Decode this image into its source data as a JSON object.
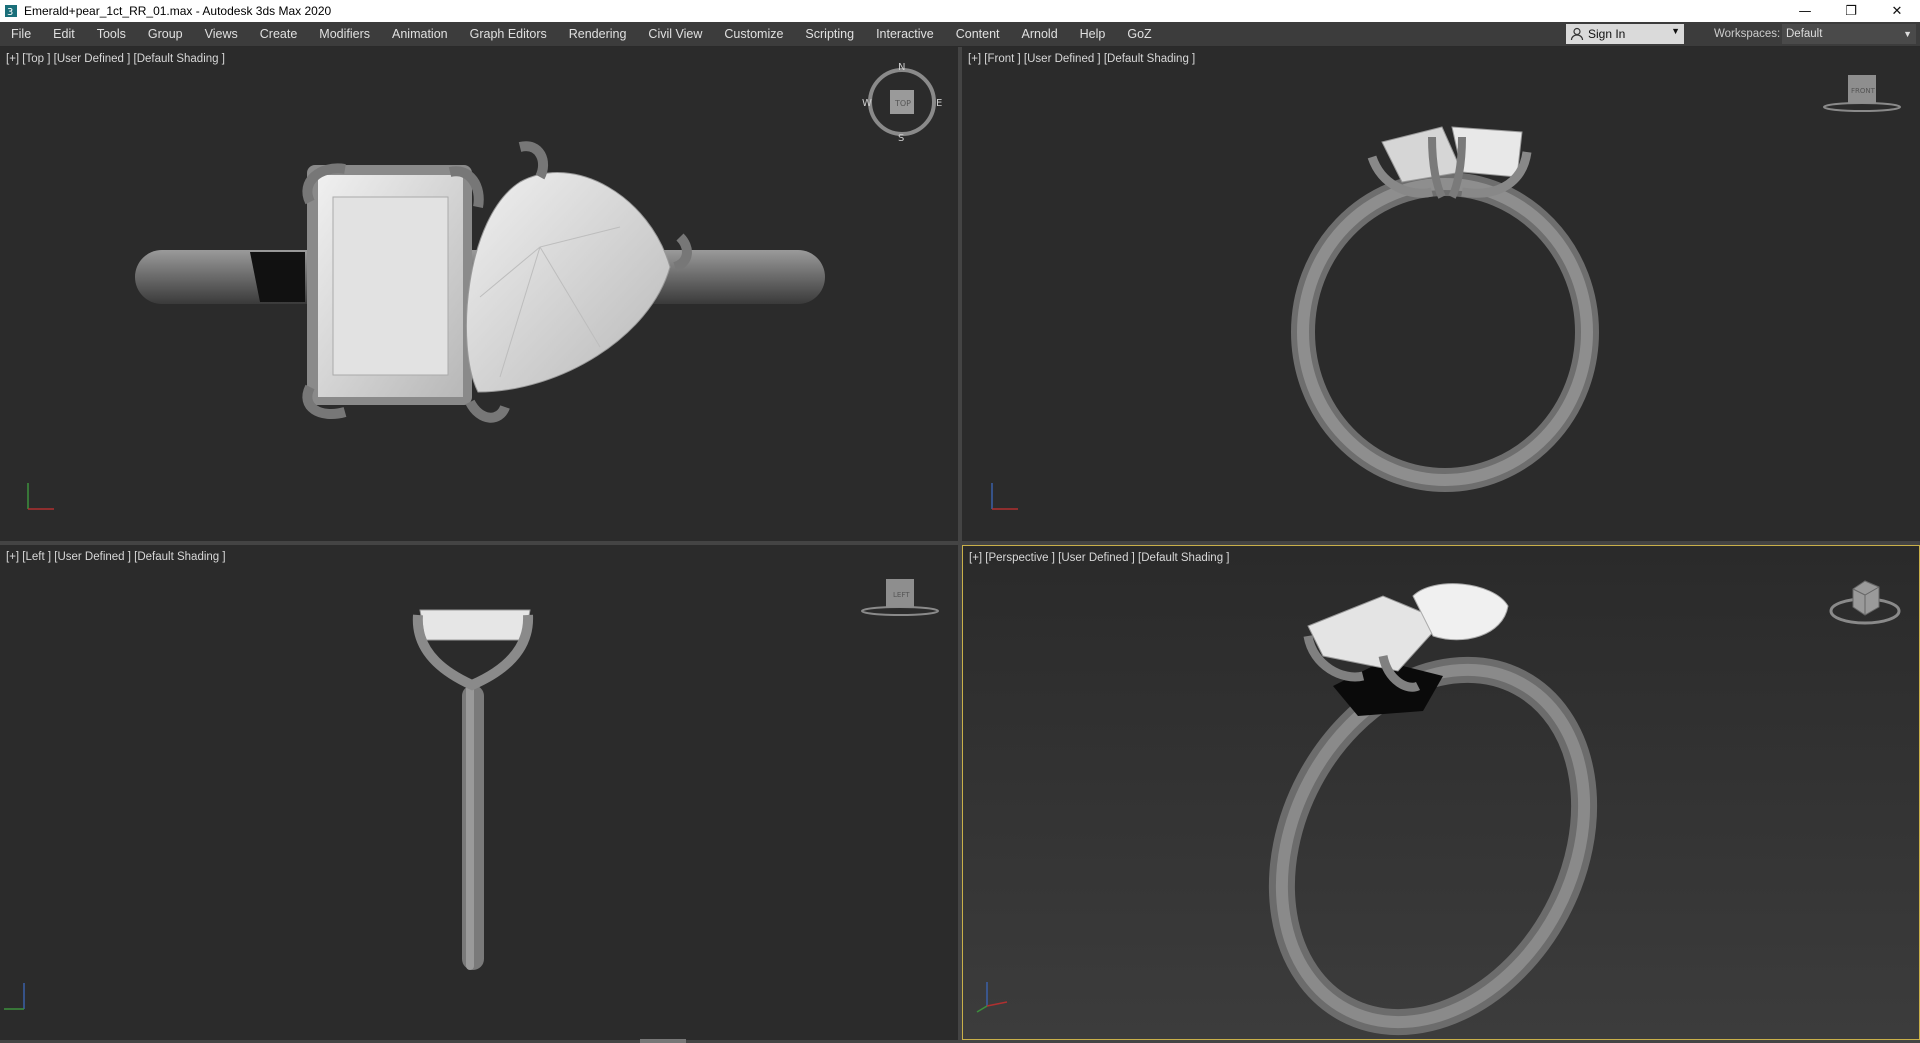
{
  "titlebar": {
    "title": "Emerald+pear_1ct_RR_01.max - Autodesk 3ds Max 2020",
    "minimize": "—",
    "restore": "❐",
    "close": "✕"
  },
  "menubar": {
    "items": [
      "File",
      "Edit",
      "Tools",
      "Group",
      "Views",
      "Create",
      "Modifiers",
      "Animation",
      "Graph Editors",
      "Rendering",
      "Civil View",
      "Customize",
      "Scripting",
      "Interactive",
      "Content",
      "Arnold",
      "Help",
      "GoZ"
    ]
  },
  "account": {
    "sign_in_label": "Sign In"
  },
  "workspace": {
    "label": "Workspaces:",
    "value": "Default"
  },
  "viewports": {
    "top": {
      "label": "[+] [Top ] [User Defined ] [Default Shading ]",
      "cube_label": "TOP",
      "compass": [
        "N",
        "E",
        "S",
        "W"
      ]
    },
    "front": {
      "label": "[+] [Front ] [User Defined ] [Default Shading ]",
      "cube_label": "FRONT"
    },
    "left": {
      "label": "[+] [Left ] [User Defined ] [Default Shading ]",
      "cube_label": "LEFT"
    },
    "perspective": {
      "label": "[+] [Perspective ] [User Defined ] [Default Shading ]"
    }
  },
  "icons": [
    "app-icon",
    "user-icon",
    "dropdown-icon",
    "viewcube-icon",
    "axis-tripod-icon"
  ]
}
